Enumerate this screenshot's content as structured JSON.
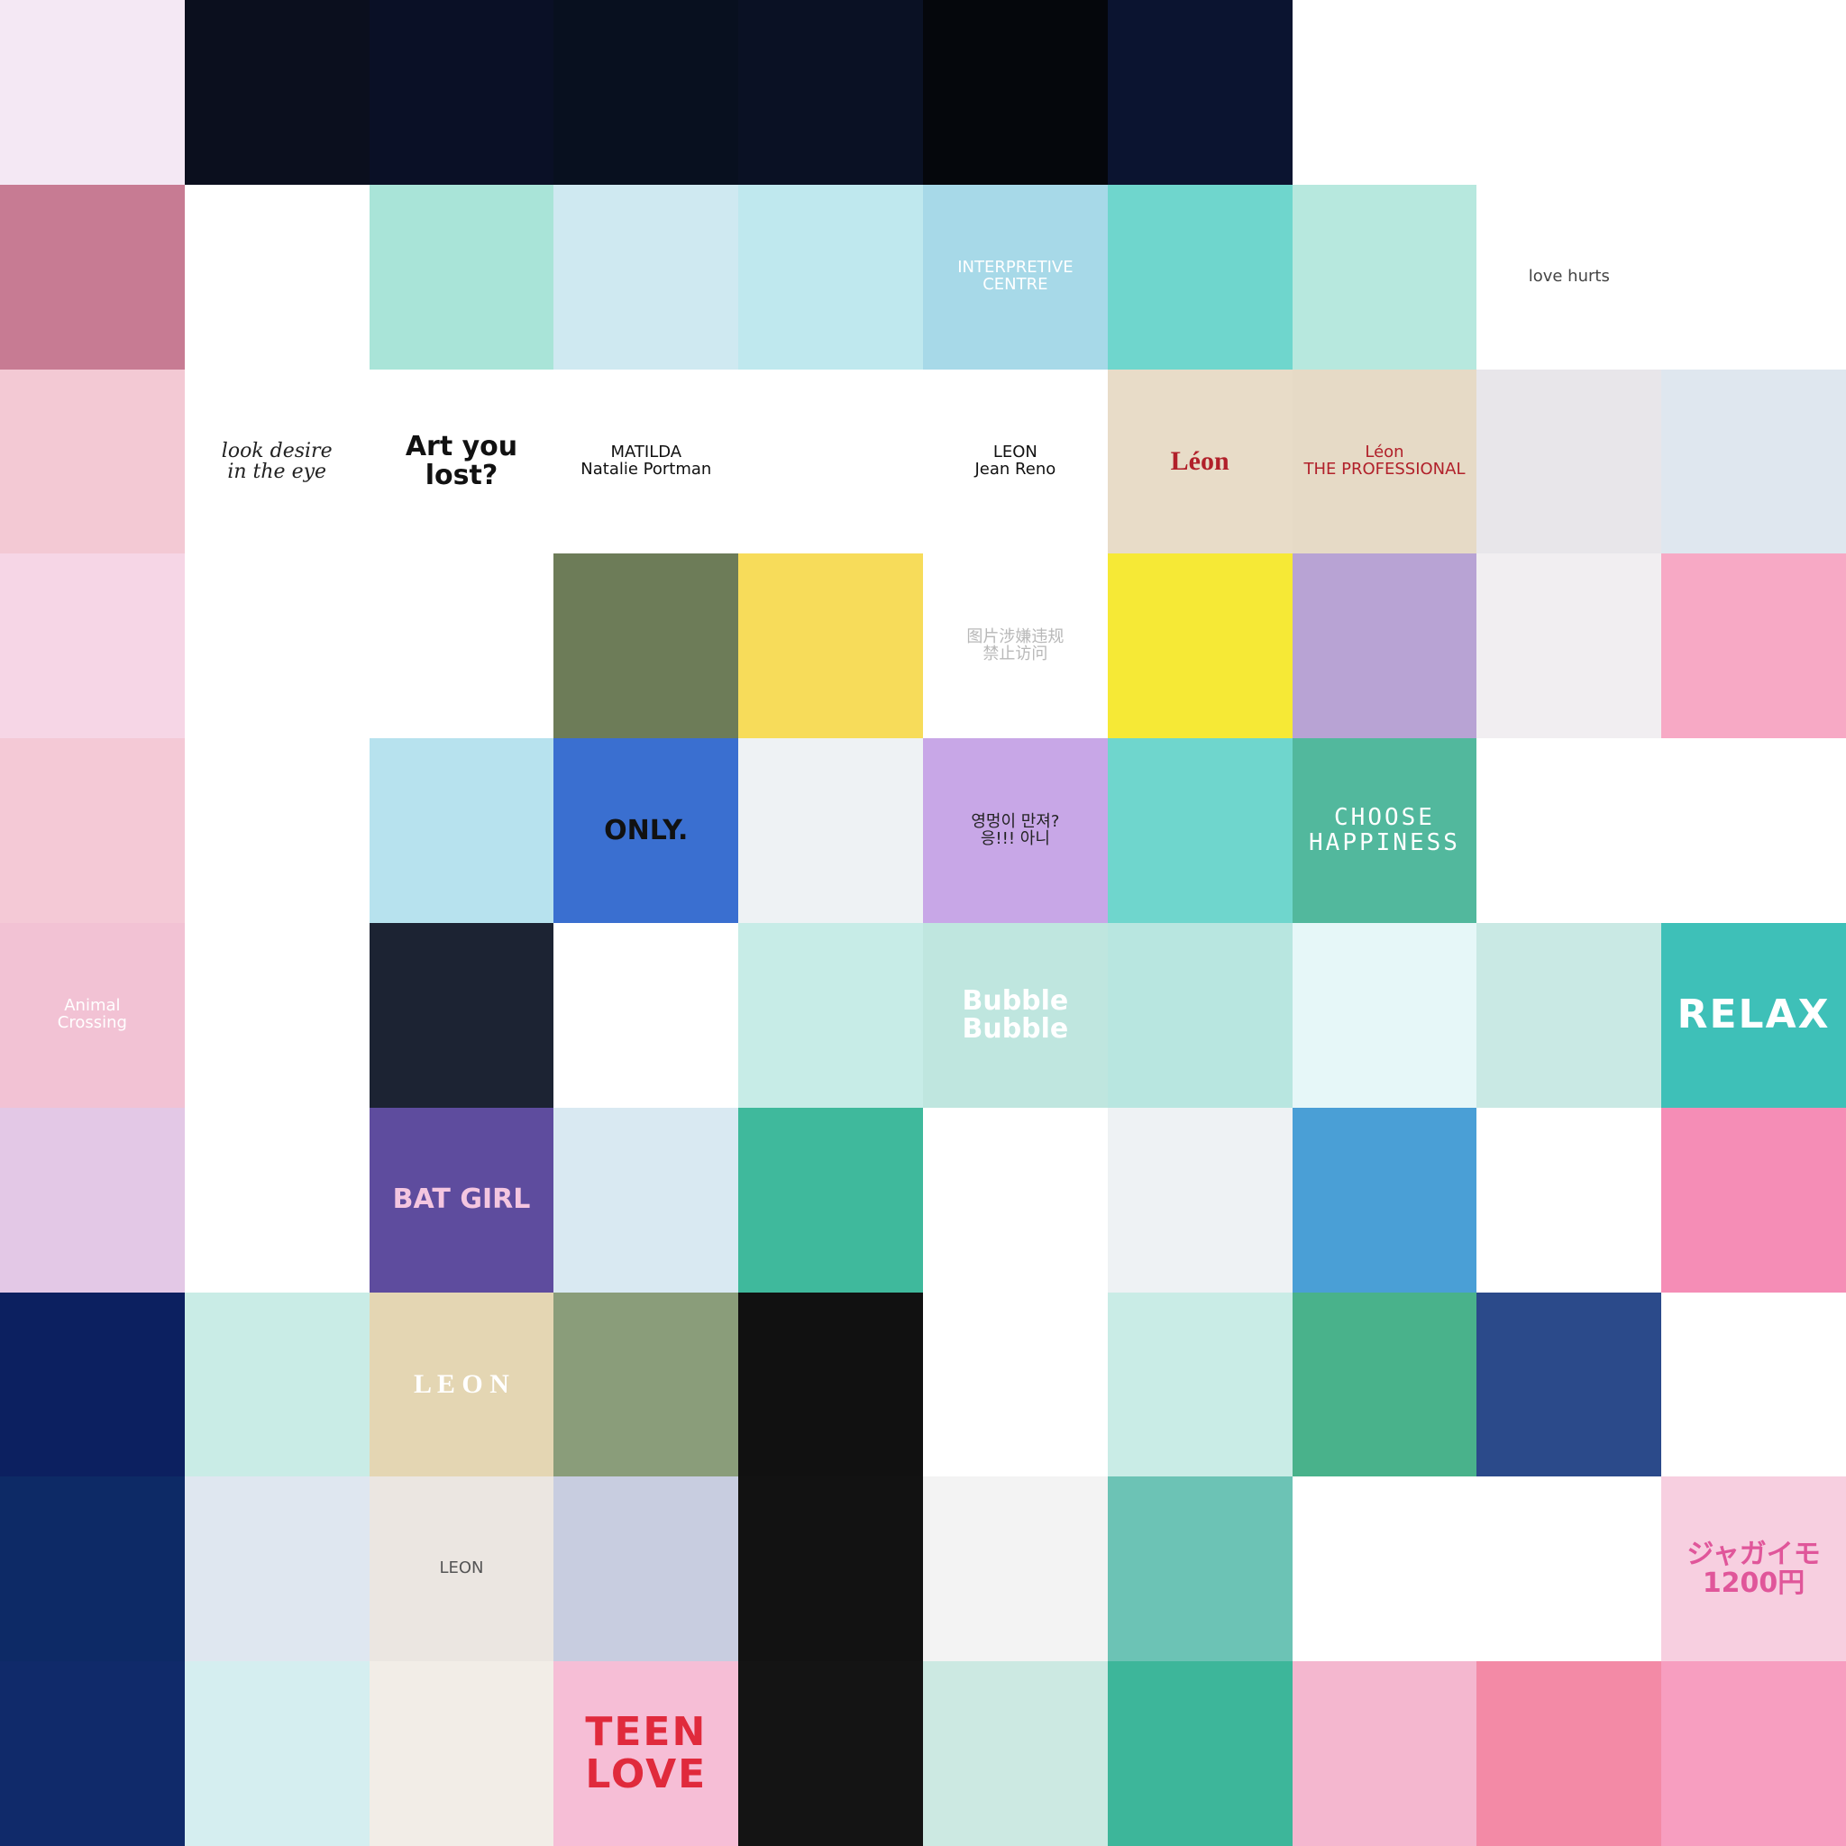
{
  "tiles": [
    {
      "bg": "#f4e8f4",
      "fg": "#3a3a3a",
      "name": "banana-illustration",
      "text": ""
    },
    {
      "bg": "#0b0f1e",
      "fg": "#ffffff",
      "name": "blue-cocktail-glass",
      "text": ""
    },
    {
      "bg": "#0a1026",
      "fg": "#ffffff",
      "name": "jellyfish-in-blue",
      "text": ""
    },
    {
      "bg": "#08101f",
      "fg": "#ffffff",
      "name": "starry-martini-glass",
      "text": ""
    },
    {
      "bg": "#0a1124",
      "fg": "#ffffff",
      "name": "blue-bottle-lemon",
      "text": ""
    },
    {
      "bg": "#05070c",
      "fg": "#ffffff",
      "name": "blue-fish",
      "text": ""
    },
    {
      "bg": "#0b1430",
      "fg": "#ffffff",
      "name": "blue-drink-glass",
      "text": ""
    },
    {
      "bg": "#ffffff",
      "fg": "#222222",
      "name": "cat-sketch",
      "text": ""
    },
    {
      "bg": "#ffffff",
      "fg": "#222222",
      "name": "black-cat",
      "text": ""
    },
    {
      "bg": "#ffffff",
      "fg": "#222222",
      "name": "figure-sketch",
      "text": ""
    },
    {
      "bg": "#c77b93",
      "fg": "#ffffff",
      "name": "pink-sparkle-photo",
      "text": ""
    },
    {
      "bg": "#ffffff",
      "fg": "#222222",
      "name": "line-art-figure",
      "text": ""
    },
    {
      "bg": "#a9e4d8",
      "fg": "#ffffff",
      "name": "flowers-by-window",
      "text": ""
    },
    {
      "bg": "#cfe9f1",
      "fg": "#ffffff",
      "name": "chain-link-fence",
      "text": ""
    },
    {
      "bg": "#bfe8ee",
      "fg": "#ffffff",
      "name": "ferris-wheel",
      "text": ""
    },
    {
      "bg": "#a7d9e8",
      "fg": "#ffffff",
      "name": "blue-building",
      "text": "INTERPRETIVE CENTRE",
      "cls": "small"
    },
    {
      "bg": "#6fd6cd",
      "fg": "#ffffff",
      "name": "sea-sparkle",
      "text": ""
    },
    {
      "bg": "#b7e8de",
      "fg": "#ffffff",
      "name": "glass-bottles",
      "text": ""
    },
    {
      "bg": "#ffffff",
      "fg": "#444444",
      "name": "love-hurts-heart",
      "text": "love hurts",
      "cls": "small"
    },
    {
      "bg": "#ffffff",
      "fg": "#c81a2a",
      "name": "red-lips",
      "text": ""
    },
    {
      "bg": "#f3c9d4",
      "fg": "#ffffff",
      "name": "pink-hand-soap",
      "text": ""
    },
    {
      "bg": "#ffffff",
      "fg": "#222222",
      "name": "look-desire-handwriting",
      "text": "look desire\nin the eye",
      "cls": "script"
    },
    {
      "bg": "#ffffff",
      "fg": "#111111",
      "name": "art-you-lost-poster",
      "text": "Art you lost?"
    },
    {
      "bg": "#ffffff",
      "fg": "#111111",
      "name": "matilda-illustration",
      "text": "MATILDA\nNatalie Portman",
      "cls": "small"
    },
    {
      "bg": "#ffffff",
      "fg": "#111111",
      "name": "leon-matilda-pair",
      "text": ""
    },
    {
      "bg": "#ffffff",
      "fg": "#111111",
      "name": "leon-illustration",
      "text": "LEON\nJean Reno",
      "cls": "small"
    },
    {
      "bg": "#e8dcc8",
      "fg": "#b1202a",
      "name": "plant-leon-poster",
      "text": "Léon",
      "cls": "serif"
    },
    {
      "bg": "#e6dac6",
      "fg": "#b1202a",
      "name": "leon-the-professional",
      "text": "Léon\nTHE PROFESSIONAL",
      "cls": "small"
    },
    {
      "bg": "#e8e6ea",
      "fg": "#ffffff",
      "name": "white-sneakers",
      "text": ""
    },
    {
      "bg": "#dfe7ef",
      "fg": "#ffffff",
      "name": "roller-coaster",
      "text": ""
    },
    {
      "bg": "#f6d6e6",
      "fg": "#ffffff",
      "name": "anime-girl-pink",
      "text": ""
    },
    {
      "bg": "#ffffff",
      "fg": "#222222",
      "name": "birds-sketch",
      "text": ""
    },
    {
      "bg": "#ffffff",
      "fg": "#7c56b6",
      "name": "pinky-promise-heart",
      "text": ""
    },
    {
      "bg": "#6d7c58",
      "fg": "#ffffff",
      "name": "sleeping-cat",
      "text": ""
    },
    {
      "bg": "#f7dc5a",
      "fg": "#ffffff",
      "name": "lemon-icecream",
      "text": ""
    },
    {
      "bg": "#ffffff",
      "fg": "#b8b8b8",
      "name": "blocked-image-notice",
      "text": "图片涉嫌违规\n禁止访问",
      "cls": "small"
    },
    {
      "bg": "#f6e936",
      "fg": "#ffffff",
      "name": "bottles-on-yellow",
      "text": ""
    },
    {
      "bg": "#b8a3d4",
      "fg": "#ffffff",
      "name": "purple-smoke",
      "text": ""
    },
    {
      "bg": "#f1eef1",
      "fg": "#ffffff",
      "name": "diamond-triangle",
      "text": ""
    },
    {
      "bg": "#f7a9c5",
      "fg": "#ffffff",
      "name": "red-skull",
      "text": ""
    },
    {
      "bg": "#f4c9d6",
      "fg": "#ffffff",
      "name": "cherry-blossoms",
      "text": ""
    },
    {
      "bg": "#ffffff",
      "fg": "#222222",
      "name": "girl-sketch-box",
      "text": ""
    },
    {
      "bg": "#b7e2ee",
      "fg": "#ffffff",
      "name": "holographic-pony",
      "text": ""
    },
    {
      "bg": "#3a6fd0",
      "fg": "#111111",
      "name": "airplane-only",
      "text": "ONLY."
    },
    {
      "bg": "#eef2f4",
      "fg": "#ffffff",
      "name": "hand-on-sweater",
      "text": ""
    },
    {
      "bg": "#c8a7e7",
      "fg": "#222222",
      "name": "anime-dialogue",
      "text": "영멍이 만져?\n응!!!   아니",
      "cls": "small"
    },
    {
      "bg": "#6fd6cd",
      "fg": "#ffffff",
      "name": "sea-sparkle-2",
      "text": ""
    },
    {
      "bg": "#52b89d",
      "fg": "#ffffff",
      "name": "choose-happiness",
      "text": "CHOOSE\nHAPPINESS",
      "cls": "mono"
    },
    {
      "bg": "#ffffff",
      "fg": "#222222",
      "name": "drink-with-straw",
      "text": ""
    },
    {
      "bg": "#ffffff",
      "fg": "#222222",
      "name": "drinks-overhead",
      "text": ""
    },
    {
      "bg": "#f2c2d4",
      "fg": "#ffffff",
      "name": "animal-crossing-3ds",
      "text": "Animal\nCrossing",
      "cls": "small"
    },
    {
      "bg": "#ffffff",
      "fg": "#222222",
      "name": "feathers-sketch",
      "text": ""
    },
    {
      "bg": "#1c2333",
      "fg": "#ffffff",
      "name": "three-eyed-girl",
      "text": ""
    },
    {
      "bg": "#ffffff",
      "fg": "#222222",
      "name": "drinks-overhead-2",
      "text": ""
    },
    {
      "bg": "#c7ece7",
      "fg": "#ffffff",
      "name": "pink-stairs",
      "text": ""
    },
    {
      "bg": "#bfe6df",
      "fg": "#ffffff",
      "name": "bubble-toothpaste",
      "text": "Bubble\nBubble"
    },
    {
      "bg": "#b8e6e0",
      "fg": "#ffffff",
      "name": "bears-on-teal",
      "text": ""
    },
    {
      "bg": "#e6f7f8",
      "fg": "#ffffff",
      "name": "pearl-shell",
      "text": ""
    },
    {
      "bg": "#c9e9e4",
      "fg": "#ffffff",
      "name": "milkshake",
      "text": ""
    },
    {
      "bg": "#3ec0b8",
      "fg": "#ffffff",
      "name": "relax-sea",
      "text": "RELAX",
      "cls": "big"
    },
    {
      "bg": "#e3c8e6",
      "fg": "#ffffff",
      "name": "pastel-wave",
      "text": ""
    },
    {
      "bg": "#ffffff",
      "fg": "#222222",
      "name": "carousel-horse",
      "text": ""
    },
    {
      "bg": "#5e4c9e",
      "fg": "#f4c6e0",
      "name": "bat-girl",
      "text": "BAT GIRL"
    },
    {
      "bg": "#d9e9f2",
      "fg": "#ffffff",
      "name": "smiley-balloon-girl",
      "text": ""
    },
    {
      "bg": "#3fb99c",
      "fg": "#ffffff",
      "name": "cap-girl",
      "text": ""
    },
    {
      "bg": "#ffffff",
      "fg": "#ffffff",
      "name": "green-cups",
      "text": ""
    },
    {
      "bg": "#eef2f4",
      "fg": "#ffffff",
      "name": "hand-on-sweater-2",
      "text": ""
    },
    {
      "bg": "#4a9fd6",
      "fg": "#ffffff",
      "name": "krusty-bench",
      "text": ""
    },
    {
      "bg": "#ffffff",
      "fg": "#ffffff",
      "name": "bart-and-charlie",
      "text": ""
    },
    {
      "bg": "#f58db6",
      "fg": "#ffffff",
      "name": "lisa-witch",
      "text": ""
    },
    {
      "bg": "#0c2060",
      "fg": "#ffffff",
      "name": "night-town",
      "text": ""
    },
    {
      "bg": "#c9ece6",
      "fg": "#ffffff",
      "name": "white-flower",
      "text": ""
    },
    {
      "bg": "#e4d6b3",
      "fg": "#ffffff",
      "name": "leon-city-poster",
      "text": "L E O N",
      "cls": "serif"
    },
    {
      "bg": "#8a9d7a",
      "fg": "#ffffff",
      "name": "green-cup-stripes",
      "text": ""
    },
    {
      "bg": "#111111",
      "fg": "#ffffff",
      "name": "ducks-chalkboard",
      "text": ""
    },
    {
      "bg": "#ffffff",
      "fg": "#ffffff",
      "name": "sunglasses-girl-flowers",
      "text": ""
    },
    {
      "bg": "#c9ece6",
      "fg": "#ffffff",
      "name": "pink-stairs-2",
      "text": ""
    },
    {
      "bg": "#49b28b",
      "fg": "#ffffff",
      "name": "simpsons-kitchen",
      "text": ""
    },
    {
      "bg": "#2b4a8a",
      "fg": "#ffffff",
      "name": "bart-arms-crossed",
      "text": ""
    },
    {
      "bg": "#ffffff",
      "fg": "#ffffff",
      "name": "bart-face",
      "text": ""
    },
    {
      "bg": "#0d2a66",
      "fg": "#ffffff",
      "name": "bear-in-sea",
      "text": ""
    },
    {
      "bg": "#dfe7f0",
      "fg": "#ffffff",
      "name": "blue-flowers-hands",
      "text": ""
    },
    {
      "bg": "#ebe6e1",
      "fg": "#555555",
      "name": "leon-small-poster",
      "text": "LEON",
      "cls": "small"
    },
    {
      "bg": "#c8cde0",
      "fg": "#ffffff",
      "name": "mountain-sunset",
      "text": ""
    },
    {
      "bg": "#121212",
      "fg": "#ffffff",
      "name": "planets-on-black",
      "text": ""
    },
    {
      "bg": "#f3f3f3",
      "fg": "#ffffff",
      "name": "mint-popsicles",
      "text": ""
    },
    {
      "bg": "#6cc3b5",
      "fg": "#ffffff",
      "name": "paper-clouds",
      "text": ""
    },
    {
      "bg": "#ffffff",
      "fg": "#ffffff",
      "name": "bart-standing",
      "text": ""
    },
    {
      "bg": "#ffffff",
      "fg": "#ffffff",
      "name": "marge-hair",
      "text": ""
    },
    {
      "bg": "#f7cfe0",
      "fg": "#e0569a",
      "name": "jagaimo-poster",
      "text": "ジャガイモ\n1200円"
    },
    {
      "bg": "#102a6a",
      "fg": "#ffffff",
      "name": "whale-night",
      "text": ""
    },
    {
      "bg": "#d5eef0",
      "fg": "#ffffff",
      "name": "lavender-field",
      "text": ""
    },
    {
      "bg": "#f2ede7",
      "fg": "#ffffff",
      "name": "leon-street",
      "text": ""
    },
    {
      "bg": "#f6bed6",
      "fg": "#e02a3c",
      "name": "teen-love",
      "text": "TEEN\nLOVE",
      "cls": "big"
    },
    {
      "bg": "#141414",
      "fg": "#ffffff",
      "name": "red-circle-girl",
      "text": ""
    },
    {
      "bg": "#cce9e2",
      "fg": "#ffffff",
      "name": "split-photo",
      "text": ""
    },
    {
      "bg": "#3db69a",
      "fg": "#ffffff",
      "name": "cap-girl-2",
      "text": ""
    },
    {
      "bg": "#f4b7cf",
      "fg": "#ffffff",
      "name": "simpsons-window",
      "text": ""
    },
    {
      "bg": "#f38aa6",
      "fg": "#ffffff",
      "name": "strawberry-heart",
      "text": ""
    },
    {
      "bg": "#f79ec0",
      "fg": "#ffffff",
      "name": "strawberries-pattern",
      "text": ""
    }
  ]
}
